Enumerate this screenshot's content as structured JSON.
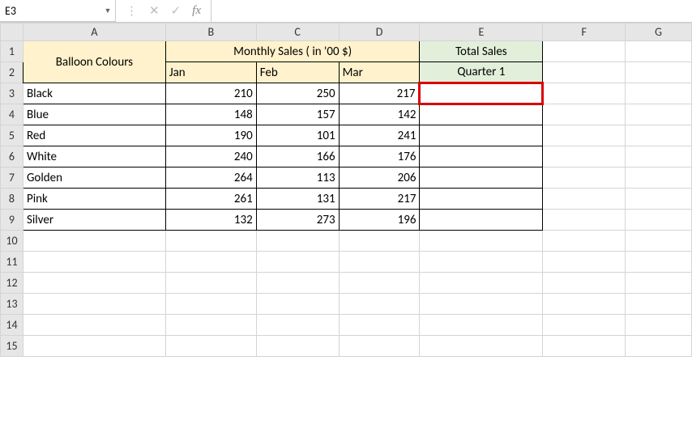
{
  "formulaBar": {
    "nameBox": "E3",
    "cancelIcon": "✕",
    "enterIcon": "✓",
    "fxLabel": "fx",
    "formulaValue": ""
  },
  "columns": [
    "A",
    "B",
    "C",
    "D",
    "E",
    "F",
    "G"
  ],
  "rows": [
    "1",
    "2",
    "3",
    "4",
    "5",
    "6",
    "7",
    "8",
    "9",
    "10",
    "11",
    "12",
    "13",
    "14",
    "15"
  ],
  "headers": {
    "balloonColours": "Balloon Colours",
    "monthlySales": "Monthly Sales ( in '00 $)",
    "jan": "Jan",
    "feb": "Feb",
    "mar": "Mar",
    "totalSales": "Total Sales",
    "quarter1": "Quarter 1"
  },
  "tableData": [
    {
      "colour": "Black",
      "jan": "210",
      "feb": "250",
      "mar": "217"
    },
    {
      "colour": "Blue",
      "jan": "148",
      "feb": "157",
      "mar": "142"
    },
    {
      "colour": "Red",
      "jan": "190",
      "feb": "101",
      "mar": "241"
    },
    {
      "colour": "White",
      "jan": "240",
      "feb": "166",
      "mar": "176"
    },
    {
      "colour": "Golden",
      "jan": "264",
      "feb": "113",
      "mar": "206"
    },
    {
      "colour": "Pink",
      "jan": "261",
      "feb": "131",
      "mar": "217"
    },
    {
      "colour": "Silver",
      "jan": "132",
      "feb": "273",
      "mar": "196"
    }
  ],
  "activeCell": "E3",
  "chart_data": {
    "type": "table",
    "title": "Monthly Sales ( in '00 $)",
    "columns": [
      "Balloon Colours",
      "Jan",
      "Feb",
      "Mar"
    ],
    "rows": [
      [
        "Black",
        210,
        250,
        217
      ],
      [
        "Blue",
        148,
        157,
        142
      ],
      [
        "Red",
        190,
        101,
        241
      ],
      [
        "White",
        240,
        166,
        176
      ],
      [
        "Golden",
        264,
        113,
        206
      ],
      [
        "Pink",
        261,
        131,
        217
      ],
      [
        "Silver",
        132,
        273,
        196
      ]
    ]
  }
}
